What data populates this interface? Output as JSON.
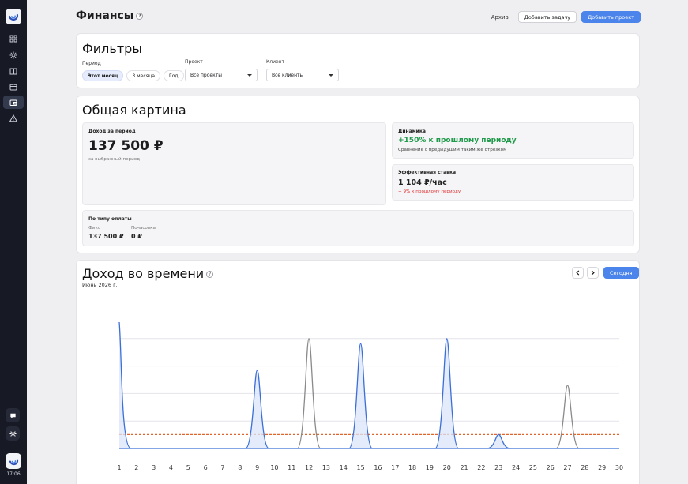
{
  "sidebar": {
    "logo": "logo-icon",
    "nav": [
      {
        "icon": "grid-icon",
        "active": false
      },
      {
        "icon": "sun-icon",
        "active": false
      },
      {
        "icon": "book-icon",
        "active": false
      },
      {
        "icon": "calendar-icon",
        "active": false
      },
      {
        "icon": "wallet-icon",
        "active": true
      },
      {
        "icon": "warning-icon",
        "active": false
      }
    ],
    "bottom": [
      {
        "icon": "chat-icon"
      },
      {
        "icon": "settings-icon"
      }
    ],
    "clock": "17:06"
  },
  "header": {
    "title": "Финансы",
    "help": "?",
    "archive": "Архив",
    "add_task": "Добавить задачу",
    "add_project": "Добавить проект"
  },
  "filters": {
    "title": "Фильтры",
    "period_label": "Период",
    "periods": [
      "Этот месяц",
      "3 месяца",
      "Год"
    ],
    "period_selected": "Этот месяц",
    "project_label": "Проект",
    "project_value": "Все проекты",
    "client_label": "Клиент",
    "client_value": "Все клиенты"
  },
  "overview": {
    "title": "Общая картина",
    "income_label": "Доход за период",
    "income_value": "137 500 ₽",
    "income_sub": "за выбранный период",
    "dynamics_label": "Динамика",
    "dynamics_value": "+150% к прошлому периоду",
    "dynamics_sub": "Сравнение с предыдущим таким же отрезком",
    "rate_label": "Эффективная ставка",
    "rate_value": "1 104 ₽/час",
    "rate_change": "+ 9% к прошлому периоду",
    "payment_label": "По типу оплаты",
    "fixed_label": "Фикс",
    "fixed_value": "137 500 ₽",
    "hourly_label": "Почасовка",
    "hourly_value": "0 ₽"
  },
  "income_chart": {
    "title": "Доход во времени",
    "help": "?",
    "month": "Июнь 2026 г.",
    "today": "Сегодня",
    "prev_icon": "chevron-left-icon",
    "next_icon": "chevron-right-icon"
  },
  "chart_data": {
    "type": "area",
    "title": "Доход во времени",
    "x": [
      1,
      2,
      3,
      4,
      5,
      6,
      7,
      8,
      9,
      10,
      11,
      12,
      13,
      14,
      15,
      16,
      17,
      18,
      19,
      20,
      21,
      22,
      23,
      24,
      25,
      26,
      27,
      28,
      29,
      30
    ],
    "grid": true,
    "average_line_color": "#e0652a",
    "colors": {
      "active": "#3b6fd8",
      "inactive": "#8a8a8a",
      "fill": "#dbe6fa"
    },
    "series": [
      {
        "values": [
          1.0,
          0,
          0,
          0,
          0,
          0,
          0,
          0,
          0.62,
          0,
          0,
          0.87,
          0,
          0,
          0.83,
          0,
          0,
          0,
          0,
          0.87,
          0,
          0,
          0.11,
          0,
          0,
          0,
          0.5,
          0,
          0,
          0
        ],
        "active": [
          true,
          false,
          false,
          false,
          false,
          false,
          false,
          false,
          true,
          false,
          false,
          false,
          false,
          false,
          true,
          false,
          false,
          false,
          false,
          true,
          false,
          false,
          true,
          false,
          false,
          false,
          false,
          false,
          false,
          false
        ]
      }
    ],
    "average": 0.11
  }
}
